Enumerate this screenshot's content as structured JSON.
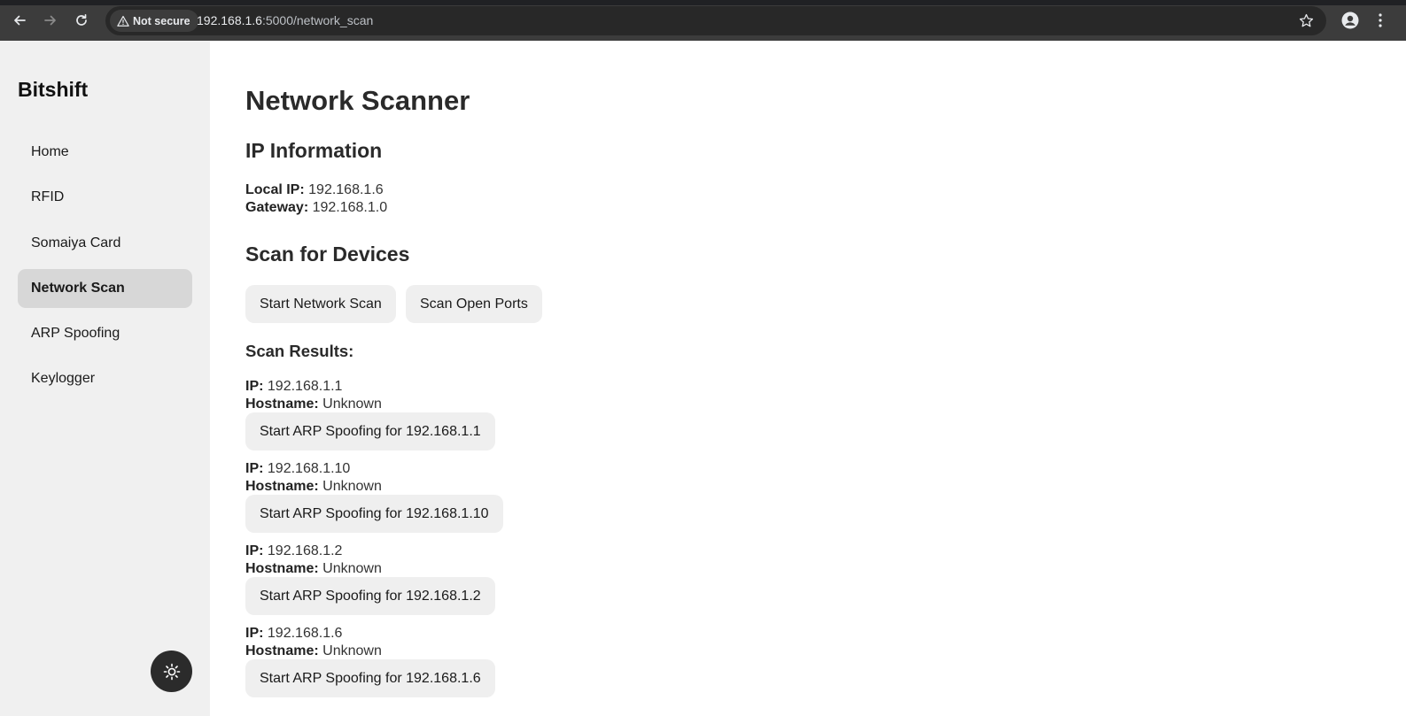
{
  "browser": {
    "security_label": "Not secure",
    "url_host": "192.168.1.6",
    "url_rest": ":5000/network_scan"
  },
  "sidebar": {
    "brand": "Bitshift",
    "items": [
      {
        "label": "Home"
      },
      {
        "label": "RFID"
      },
      {
        "label": "Somaiya Card"
      },
      {
        "label": "Network Scan",
        "active": true
      },
      {
        "label": "ARP Spoofing"
      },
      {
        "label": "Keylogger"
      }
    ]
  },
  "main": {
    "title": "Network Scanner",
    "ip_info": {
      "heading": "IP Information",
      "local_ip_label": "Local IP:",
      "local_ip": "192.168.1.6",
      "gateway_label": "Gateway:",
      "gateway": "192.168.1.0"
    },
    "scan": {
      "heading": "Scan for Devices",
      "start_scan_label": "Start Network Scan",
      "scan_ports_label": "Scan Open Ports"
    },
    "results": {
      "heading": "Scan Results:",
      "ip_label": "IP:",
      "hostname_label": "Hostname:",
      "devices": [
        {
          "ip": "192.168.1.1",
          "hostname": "Unknown",
          "action": "Start ARP Spoofing for 192.168.1.1"
        },
        {
          "ip": "192.168.1.10",
          "hostname": "Unknown",
          "action": "Start ARP Spoofing for 192.168.1.10"
        },
        {
          "ip": "192.168.1.2",
          "hostname": "Unknown",
          "action": "Start ARP Spoofing for 192.168.1.2"
        },
        {
          "ip": "192.168.1.6",
          "hostname": "Unknown",
          "action": "Start ARP Spoofing for 192.168.1.6"
        }
      ]
    }
  },
  "colors": {
    "sidebar_bg": "#f0f0f0",
    "active_nav_bg": "#d7d7d7",
    "button_bg": "#efefef",
    "toggle_bg": "#2b2b2b"
  },
  "icons": [
    "back-arrow-icon",
    "forward-arrow-icon",
    "reload-icon",
    "warning-icon",
    "star-icon",
    "profile-icon",
    "more-vert-icon",
    "sun-icon"
  ]
}
